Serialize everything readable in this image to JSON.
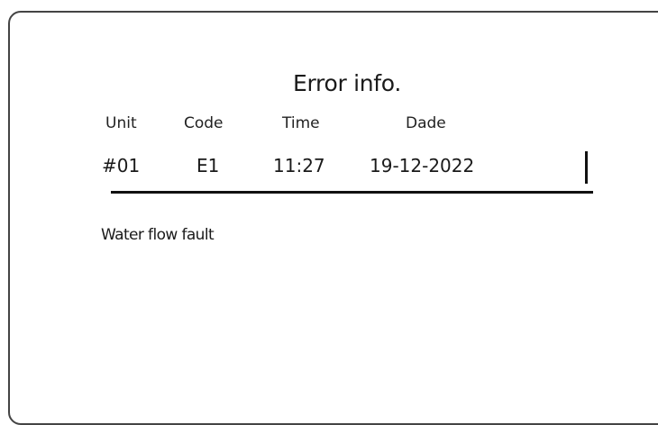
{
  "title": "Error info.",
  "columns": {
    "unit": "Unit",
    "code": "Code",
    "time": "Time",
    "date": "Dade"
  },
  "record": {
    "unit": "#01",
    "code": "E1",
    "time": "11:27",
    "date": "19-12-2022"
  },
  "description": "Water flow fault"
}
